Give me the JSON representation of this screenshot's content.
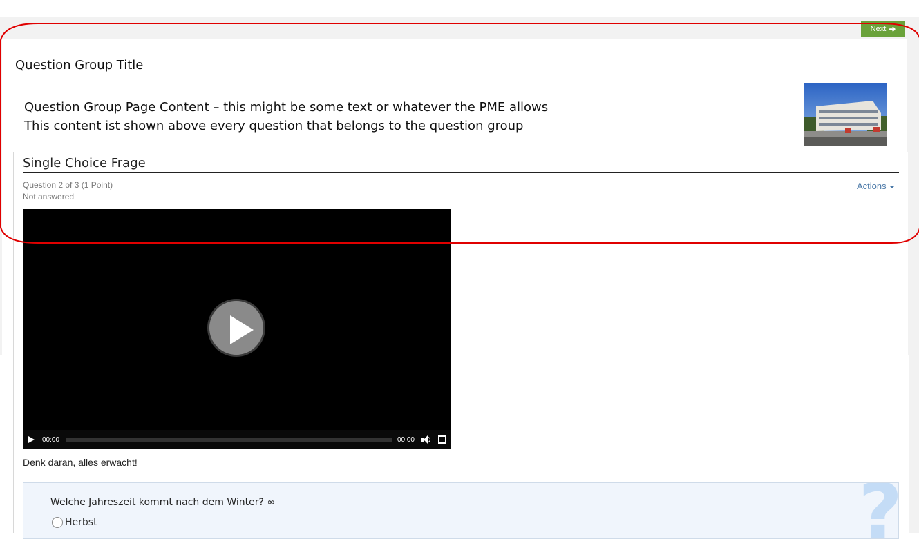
{
  "nav": {
    "next_label": "Next"
  },
  "group": {
    "title": "Question Group Title",
    "content_line_1": "Question  Group Page Content – this might be some text or whatever the PME allows",
    "content_line_2": "This content ist shown above every question that belongs to the question group"
  },
  "question": {
    "title": "Single Choice Frage",
    "progress": "Question 2 of 3 (1 Point)",
    "status": "Not answered",
    "actions_label": "Actions",
    "hint": "Denk daran, alles erwacht!",
    "prompt": "Welche Jahreszeit kommt nach dem Winter? ∞",
    "options": [
      "Herbst"
    ],
    "help_mark": "?"
  },
  "video": {
    "current_time": "00:00",
    "duration": "00:00",
    "progress": 0
  },
  "colors": {
    "next_button": "#6aa23a",
    "annotation_outline": "#e00000",
    "link": "#4b79a8",
    "question_box_bg": "#f0f5fc",
    "help_mark": "#c4dcf6"
  },
  "icons": {
    "next": "arrow-right-icon",
    "play": "play-icon",
    "volume": "volume-icon",
    "fullscreen": "fullscreen-icon",
    "actions": "caret-down-icon",
    "help": "question-mark-icon"
  }
}
